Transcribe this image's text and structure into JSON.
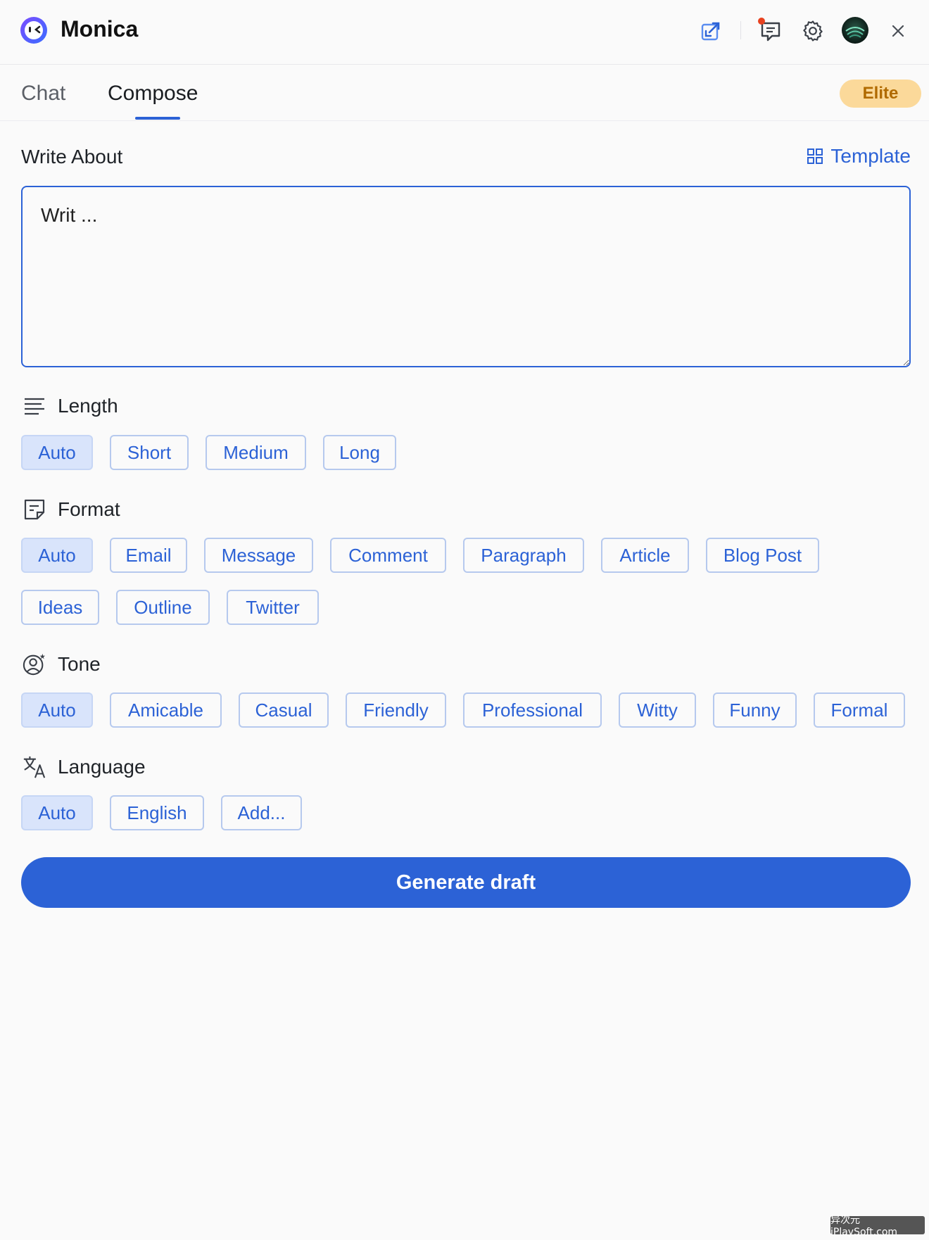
{
  "app": {
    "title": "Monica"
  },
  "tabs": [
    {
      "label": "Chat",
      "active": false
    },
    {
      "label": "Compose",
      "active": true
    }
  ],
  "plan_badge": "Elite",
  "write_about": {
    "title": "Write About",
    "template_label": "Template",
    "input_value": "Writ ..."
  },
  "length": {
    "title": "Length",
    "options": [
      "Auto",
      "Short",
      "Medium",
      "Long"
    ],
    "selected": "Auto"
  },
  "format": {
    "title": "Format",
    "options": [
      "Auto",
      "Email",
      "Message",
      "Comment",
      "Paragraph",
      "Article",
      "Blog Post",
      "Ideas",
      "Outline",
      "Twitter"
    ],
    "selected": "Auto"
  },
  "tone": {
    "title": "Tone",
    "options": [
      "Auto",
      "Amicable",
      "Casual",
      "Friendly",
      "Professional",
      "Witty",
      "Funny",
      "Formal"
    ],
    "selected": "Auto"
  },
  "language": {
    "title": "Language",
    "options": [
      "Auto",
      "English",
      "Add..."
    ],
    "selected": "Auto"
  },
  "generate_label": "Generate draft",
  "watermark": "异次元 iPlaySoft.com",
  "colors": {
    "accent": "#2c62d6",
    "chip_active": "#d9e4fb",
    "elite_bg": "#fbd99a",
    "elite_text": "#b06a00"
  },
  "icons": {
    "header": [
      "monica-logo-icon",
      "open-window-icon",
      "feedback-icon",
      "settings-gear-icon",
      "avatar",
      "close-icon"
    ],
    "sections": [
      "length-lines-icon",
      "format-note-icon",
      "tone-person-icon",
      "language-translate-icon",
      "template-grid-icon"
    ]
  }
}
